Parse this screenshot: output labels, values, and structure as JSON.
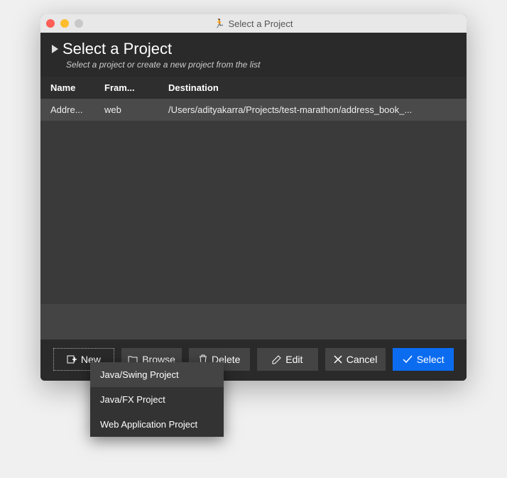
{
  "window": {
    "title": "Select a Project"
  },
  "header": {
    "title": "Select a Project",
    "subtitle": "Select a project or create a new project from the list"
  },
  "table": {
    "columns": {
      "name": "Name",
      "framework": "Fram...",
      "destination": "Destination"
    },
    "rows": [
      {
        "name": "Addre...",
        "framework": "web",
        "destination": "/Users/adityakarra/Projects/test-marathon/address_book_..."
      }
    ]
  },
  "buttons": {
    "new": "New",
    "browse": "Browse",
    "delete": "Delete",
    "edit": "Edit",
    "cancel": "Cancel",
    "select": "Select"
  },
  "dropdown": {
    "items": [
      "Java/Swing Project",
      "Java/FX Project",
      "Web Application Project"
    ]
  }
}
